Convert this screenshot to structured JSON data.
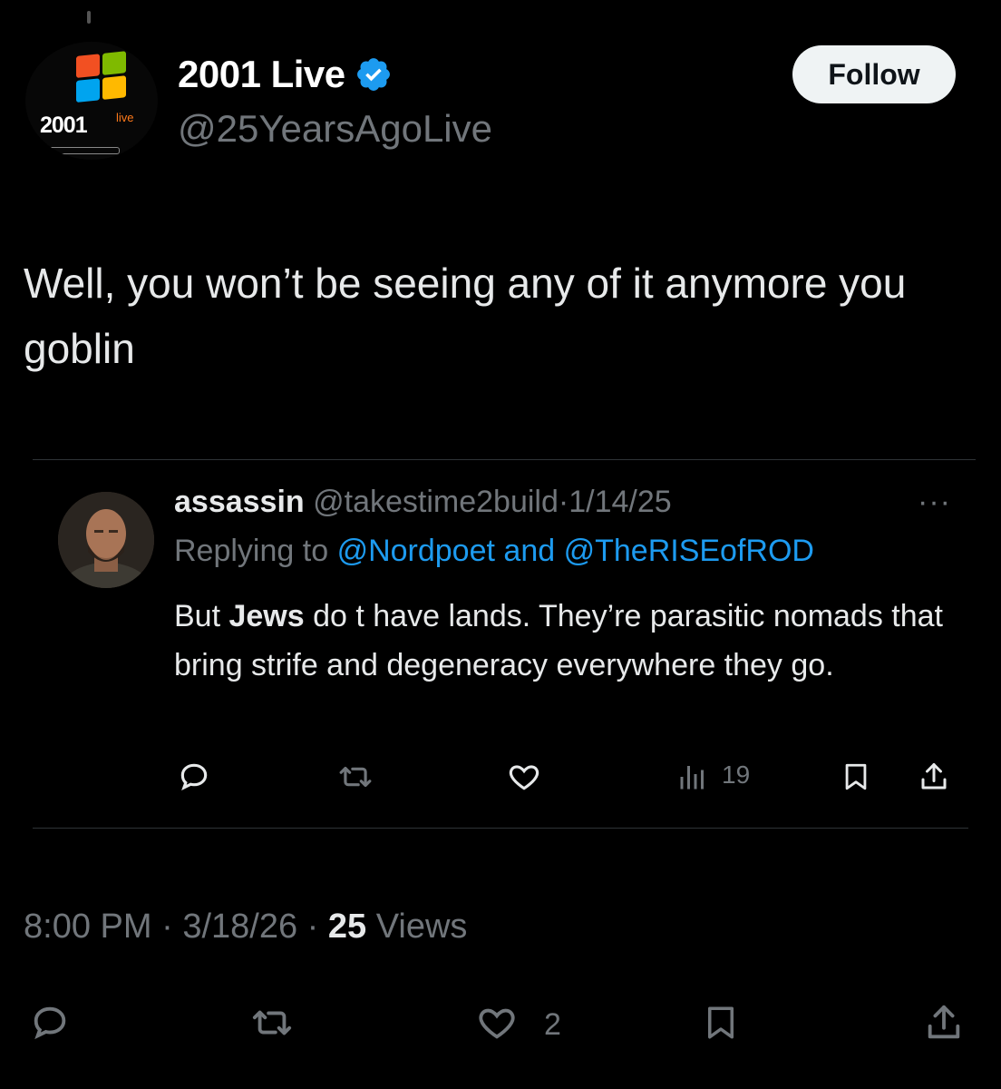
{
  "account": {
    "avatar_text": "2001",
    "avatar_sup": "live",
    "name": "2001 Live",
    "handle": "@25YearsAgoLive",
    "follow_label": "Follow"
  },
  "tweet": {
    "text": "Well, you won’t be seeing any of it anymore you goblin"
  },
  "quoted": {
    "name": "assassin",
    "handle": "@takestime2build",
    "separator": "·",
    "date": "1/14/25",
    "more": "···",
    "replying_prefix": "Replying to",
    "mention_1": "@Nordpoet",
    "and": "and",
    "mention_2": "@TheRISEofROD",
    "text_before": "But ",
    "text_bold": "Jews",
    "text_after": " do t have lands. They’re parasitic nomads that bring strife and degeneracy everywhere they go.",
    "views_count": "19"
  },
  "meta": {
    "time": "8:00 PM",
    "separator": "·",
    "date": "3/18/26",
    "views_count": "25",
    "views_label": "Views"
  },
  "actions": {
    "like_count": "2"
  },
  "colors": {
    "background": "#000000",
    "text": "#e7e9ea",
    "muted": "#71767b",
    "link": "#1d9bf0",
    "verified": "#1d9bf0",
    "divider": "#2f3336"
  },
  "icons": {
    "verified": "verified-badge-icon",
    "reply": "reply-icon",
    "retweet": "retweet-icon",
    "like": "heart-icon",
    "views": "views-chart-icon",
    "bookmark": "bookmark-icon",
    "share": "share-icon"
  }
}
